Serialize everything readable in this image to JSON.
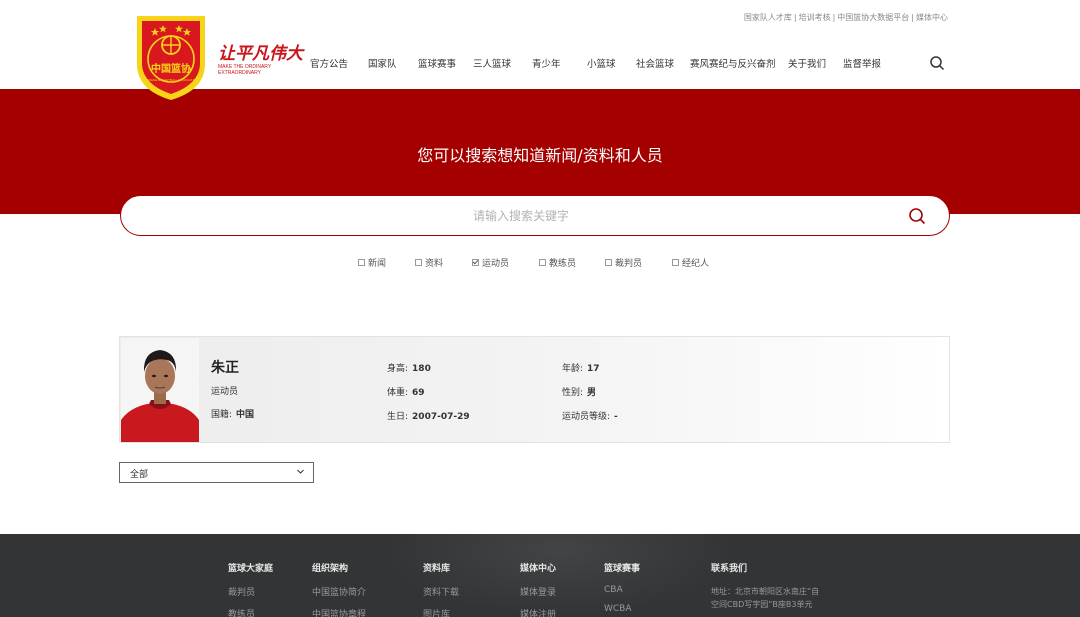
{
  "header": {
    "slogan": "让平凡伟大",
    "slogan_sub": "MAKE THE ORDINARY EXTRAORDINARY",
    "top_links": [
      "国家队人才库",
      "培训考核",
      "中国篮协大数据平台",
      "媒体中心"
    ],
    "nav": [
      "官方公告",
      "国家队",
      "篮球赛事",
      "三人篮球",
      "青少年",
      "小篮球",
      "社会篮球",
      "赛风赛纪与反兴奋剂",
      "关于我们",
      "监督举报"
    ]
  },
  "logo": {
    "text_top": "中国篮协",
    "text_ring": "CHINESE BASKETBALL ASSOCIATION"
  },
  "banner": {
    "title": "您可以搜索想知道新闻/资料和人员"
  },
  "search": {
    "placeholder": "请输入搜索关键字"
  },
  "filters": [
    {
      "label": "新闻",
      "checked": false
    },
    {
      "label": "资料",
      "checked": false
    },
    {
      "label": "运动员",
      "checked": true
    },
    {
      "label": "教练员",
      "checked": false
    },
    {
      "label": "裁判员",
      "checked": false
    },
    {
      "label": "经纪人",
      "checked": false
    }
  ],
  "person": {
    "name": "朱正",
    "role": "运动员",
    "nationality_label": "国籍:",
    "nationality": "中国",
    "height_label": "身高:",
    "height": "180",
    "weight_label": "体重:",
    "weight": "69",
    "birthday_label": "生日:",
    "birthday": "2007-07-29",
    "age_label": "年龄:",
    "age": "17",
    "gender_label": "性别:",
    "gender": "男",
    "level_label": "运动员等级:",
    "level": "-"
  },
  "dropdown": {
    "selected": "全部"
  },
  "footer": {
    "columns": [
      {
        "head": "篮球大家庭",
        "links": [
          "裁判员",
          "教练员"
        ]
      },
      {
        "head": "组织架构",
        "links": [
          "中国篮协简介",
          "中国篮协章程"
        ]
      },
      {
        "head": "资料库",
        "links": [
          "资料下载",
          "图片库"
        ]
      },
      {
        "head": "媒体中心",
        "links": [
          "媒体登录",
          "媒体注册"
        ]
      },
      {
        "head": "篮球赛事",
        "links": [
          "CBA",
          "WCBA"
        ]
      }
    ],
    "contact_head": "联系我们",
    "address": "地址：北京市朝阳区水南庄“自空间CBD写字园”B座B3单元"
  }
}
